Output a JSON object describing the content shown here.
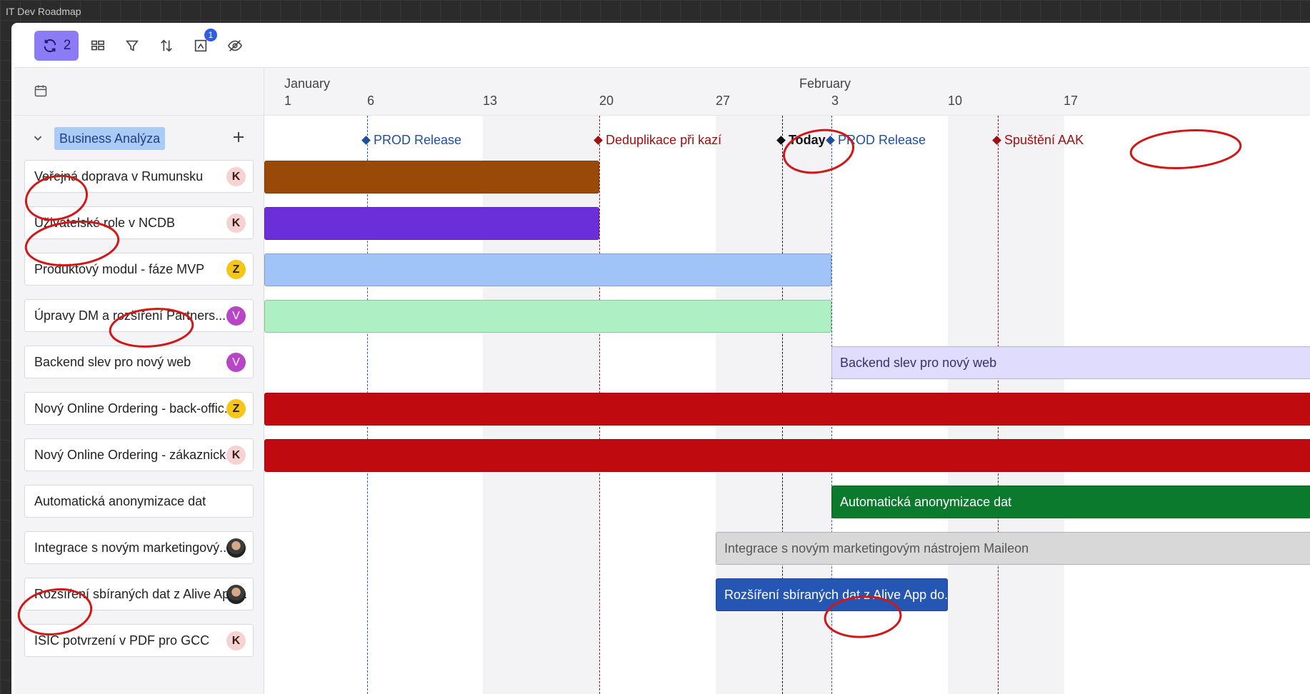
{
  "app": {
    "title": "IT Dev Roadmap"
  },
  "toolbar": {
    "sync_count": "2",
    "badge_count": "1",
    "icons": [
      "sync-icon",
      "group-icon",
      "filter-icon",
      "sort-icon",
      "layout-icon",
      "hide-icon"
    ]
  },
  "timeline": {
    "months": [
      "January",
      "February"
    ],
    "days": [
      "1",
      "6",
      "13",
      "20",
      "27",
      "3",
      "10",
      "17"
    ]
  },
  "group": {
    "name": "Business Analýza"
  },
  "items": [
    {
      "label": "Veřejná doprava v Rumunsku",
      "avatar": "K",
      "avatar_type": "k"
    },
    {
      "label": "Uživatelské role v NCDB",
      "avatar": "K",
      "avatar_type": "k"
    },
    {
      "label": "Produktový modul - fáze MVP",
      "avatar": "Z",
      "avatar_type": "z"
    },
    {
      "label": "Úpravy DM a rozšíření Partners...",
      "avatar": "V",
      "avatar_type": "v"
    },
    {
      "label": "Backend slev pro nový web",
      "avatar": "V",
      "avatar_type": "v"
    },
    {
      "label": "Nový Online Ordering - back-offic...",
      "avatar": "Z",
      "avatar_type": "z"
    },
    {
      "label": "Nový Online Ordering - zákaznick...",
      "avatar": "K",
      "avatar_type": "k"
    },
    {
      "label": "Automatická anonymizace dat",
      "avatar": "",
      "avatar_type": "none"
    },
    {
      "label": "Integrace s novým marketingový...",
      "avatar": "",
      "avatar_type": "photo"
    },
    {
      "label": "Rozšíření sbíraných dat z Alive App...",
      "avatar": "",
      "avatar_type": "photo"
    },
    {
      "label": "ISIC potvrzení v PDF pro GCC",
      "avatar": "K",
      "avatar_type": "k"
    }
  ],
  "milestones": [
    {
      "label": "PROD Release",
      "color": "#1f4e9a"
    },
    {
      "label": "Deduplikace při kazí",
      "color": "#a01010"
    },
    {
      "label": "Today",
      "color": "#111111"
    },
    {
      "label": "PROD Release",
      "color": "#1f4e9a"
    },
    {
      "label": "Spuštění AAK",
      "color": "#a01010"
    }
  ],
  "bars": [
    {
      "label": "",
      "color": "#9a4a08"
    },
    {
      "label": "",
      "color": "#6a2fd8"
    },
    {
      "label": "",
      "color": "#a1c4f8"
    },
    {
      "label": "",
      "color": "#aef0c4"
    },
    {
      "label": "Backend slev pro nový web",
      "color": "#e0dcfd"
    },
    {
      "label": "",
      "color": "#bf0a0f"
    },
    {
      "label": "",
      "color": "#bf0a0f"
    },
    {
      "label": "Automatická anonymizace dat",
      "color": "#0b7a2c"
    },
    {
      "label": "Integrace s novým marketingovým nástrojem Maileon",
      "color": "#d8d8d8"
    },
    {
      "label": "Rozšíření sbíraných dat z Alive App do...",
      "color": "#2656b3"
    }
  ]
}
